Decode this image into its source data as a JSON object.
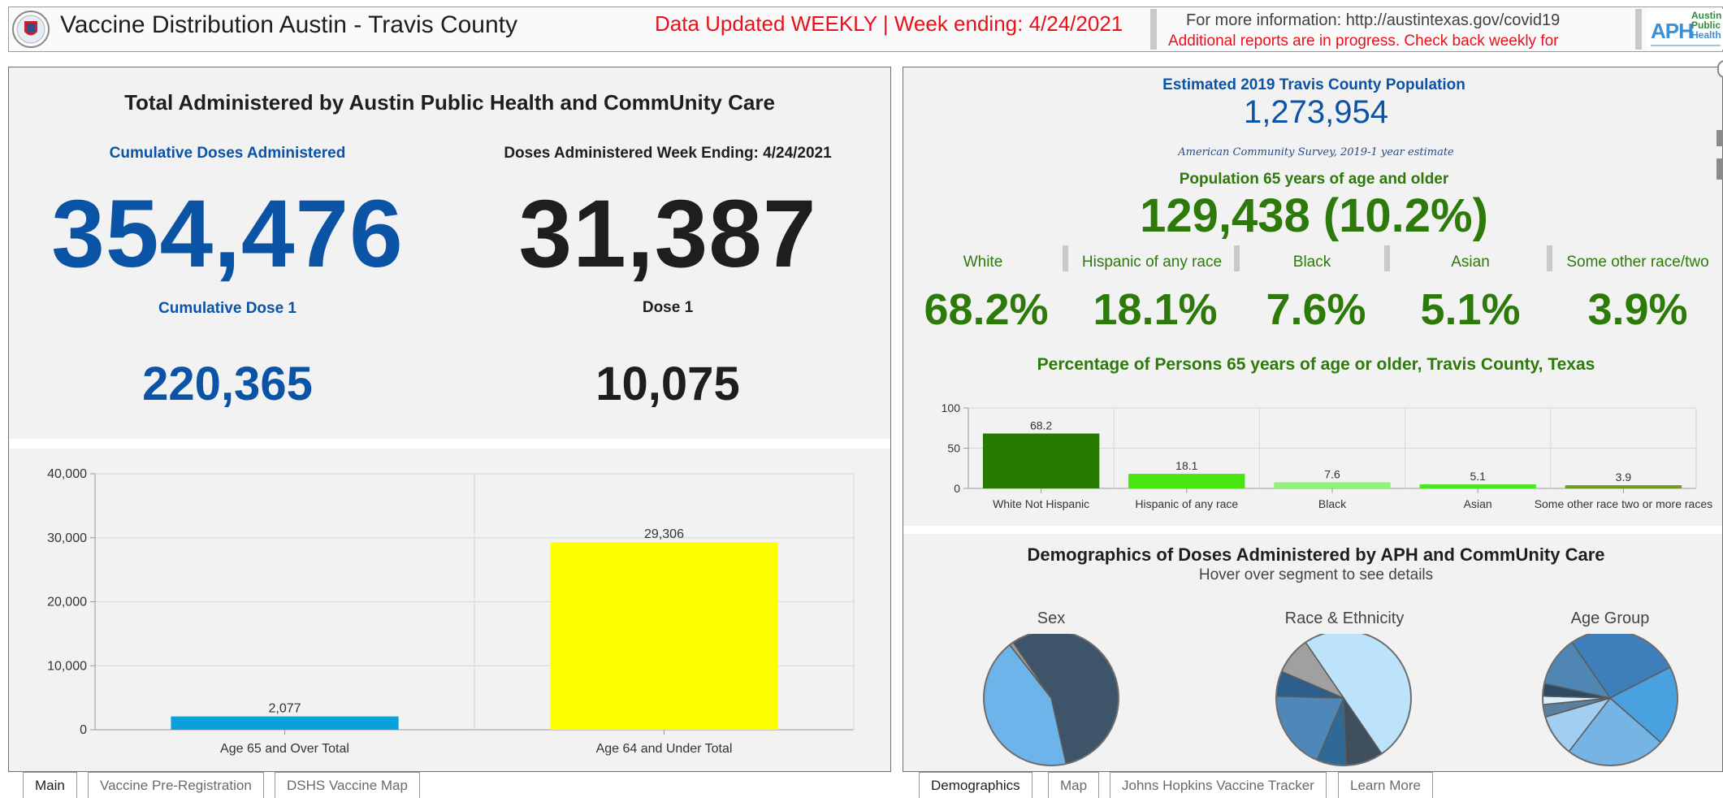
{
  "header": {
    "title": "Vaccine Distribution Austin - Travis County",
    "updated": "Data Updated WEEKLY  | Week ending:  4/24/2021",
    "info_line1": "For more information: http://austintexas.gov/covid19",
    "info_line2": "Additional reports are in progress. Check back weekly for",
    "aph_logo_letters": "APH",
    "aph_logo_words": [
      "Austin",
      "Public",
      "Health"
    ]
  },
  "admin": {
    "title": "Total Administered by Austin Public Health and CommUnity Care",
    "cum_label": "Cumulative Doses Administered",
    "cum_value": "354,476",
    "week_label": "Doses Administered Week Ending: 4/24/2021",
    "week_value": "31,387",
    "cum_dose1_label": "Cumulative Dose 1",
    "cum_dose1_value": "220,365",
    "dose1_label": "Dose 1",
    "dose1_value": "10,075"
  },
  "population": {
    "est_label": "Estimated 2019 Travis County Population",
    "est_value": "1,273,954",
    "source": "American Community Survey, 2019-1 year estimate",
    "senior_label": "Population 65 years of age and older",
    "senior_value": "129,438 (10.2%)",
    "groups": [
      {
        "label": "White",
        "pct": "68.2%"
      },
      {
        "label": "Hispanic of any race",
        "pct": "18.1%"
      },
      {
        "label": "Black",
        "pct": "7.6%"
      },
      {
        "label": "Asian",
        "pct": "5.1%"
      },
      {
        "label": "Some other race/two",
        "pct": "3.9%"
      }
    ],
    "pct_chart_title": "Percentage of  Persons 65 years of age or older, Travis County, Texas"
  },
  "demographics": {
    "title": "Demographics of Doses Administered by APH and CommUnity Care",
    "subtitle": "Hover over segment to see details",
    "pies": [
      {
        "label": "Sex",
        "slices": [
          {
            "value": 56,
            "color": "#3e5468"
          },
          {
            "value": 43,
            "color": "#6db4ea"
          },
          {
            "value": 1,
            "color": "#9a9a9a"
          }
        ]
      },
      {
        "label": "Race & Ethnicity",
        "slices": [
          {
            "value": 50,
            "color": "#bde3fb"
          },
          {
            "value": 9,
            "color": "#3f4f5e"
          },
          {
            "value": 7,
            "color": "#2f6a97"
          },
          {
            "value": 19,
            "color": "#4e87b8"
          },
          {
            "value": 6,
            "color": "#2d5f8a"
          },
          {
            "value": 9,
            "color": "#a0a0a0"
          }
        ]
      },
      {
        "label": "Age Group",
        "slices": [
          {
            "value": 27,
            "color": "#3e7fbb"
          },
          {
            "value": 19,
            "color": "#4aa1e0"
          },
          {
            "value": 24,
            "color": "#76b4e6"
          },
          {
            "value": 10,
            "color": "#a2cef2"
          },
          {
            "value": 3,
            "color": "#5b7f9e"
          },
          {
            "value": 2,
            "color": "#dfeefb"
          },
          {
            "value": 3,
            "color": "#2c4a63"
          },
          {
            "value": 12,
            "color": "#4f86b4"
          }
        ]
      }
    ]
  },
  "tabs_left": [
    "Main",
    "Vaccine Pre-Registration",
    "DSHS Vaccine Map"
  ],
  "tabs_right": [
    "Demographics",
    "Map",
    "Johns Hopkins Vaccine Tracker",
    "Learn More"
  ],
  "chart_data": [
    {
      "type": "bar",
      "categories": [
        "Age 65 and Over Total",
        "Age 64 and Under Total"
      ],
      "values": [
        2077,
        29306
      ],
      "value_labels": [
        "2,077",
        "29,306"
      ],
      "colors": [
        "#0aa0dc",
        "#ffff00"
      ],
      "ylim": [
        0,
        40000
      ],
      "yticks": [
        0,
        10000,
        20000,
        30000,
        40000
      ],
      "ytick_labels": [
        "0",
        "10,000",
        "20,000",
        "30,000",
        "40,000"
      ],
      "grid": true
    },
    {
      "type": "bar",
      "categories": [
        "White Not Hispanic",
        "Hispanic of any race",
        "Black",
        "Asian",
        "Some other race two or more races"
      ],
      "values": [
        68.2,
        18.1,
        7.6,
        5.1,
        3.9
      ],
      "value_labels": [
        "68.2",
        "18.1",
        "7.6",
        "5.1",
        "3.9"
      ],
      "colors": [
        "#267a00",
        "#48e60e",
        "#90f278",
        "#50e32a",
        "#6e9a22"
      ],
      "ylim": [
        0,
        100
      ],
      "yticks": [
        0,
        50,
        100
      ],
      "ytick_labels": [
        "0",
        "50",
        "100"
      ],
      "grid": true
    }
  ]
}
